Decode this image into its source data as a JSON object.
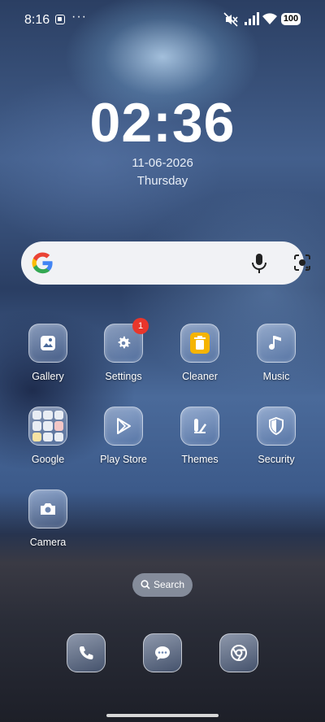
{
  "status_bar": {
    "time": "8:16",
    "more": "···",
    "battery": "100"
  },
  "clock": {
    "time": "02:36",
    "date": "11-06-2026",
    "day": "Thursday"
  },
  "google_search": {
    "icons": [
      "google-logo",
      "mic-icon",
      "lens-icon"
    ]
  },
  "apps": [
    {
      "label": "Gallery",
      "icon": "gallery-icon"
    },
    {
      "label": "Settings",
      "icon": "gear-icon",
      "badge": "1"
    },
    {
      "label": "Cleaner",
      "icon": "trash-icon"
    },
    {
      "label": "Music",
      "icon": "music-note-icon"
    },
    {
      "label": "Google",
      "icon": "folder-icon"
    },
    {
      "label": "Play Store",
      "icon": "play-store-icon"
    },
    {
      "label": "Themes",
      "icon": "themes-icon"
    },
    {
      "label": "Security",
      "icon": "shield-icon"
    },
    {
      "label": "Camera",
      "icon": "camera-icon"
    }
  ],
  "search_pill": {
    "label": "Search"
  },
  "dock": [
    {
      "name": "phone",
      "icon": "phone-icon"
    },
    {
      "name": "messages",
      "icon": "chat-icon"
    },
    {
      "name": "chrome",
      "icon": "chrome-icon"
    }
  ],
  "colors": {
    "badge": "#e8362b",
    "cleaner_icon": "#f5b400",
    "search_bar_bg": "#f1f2f5"
  }
}
